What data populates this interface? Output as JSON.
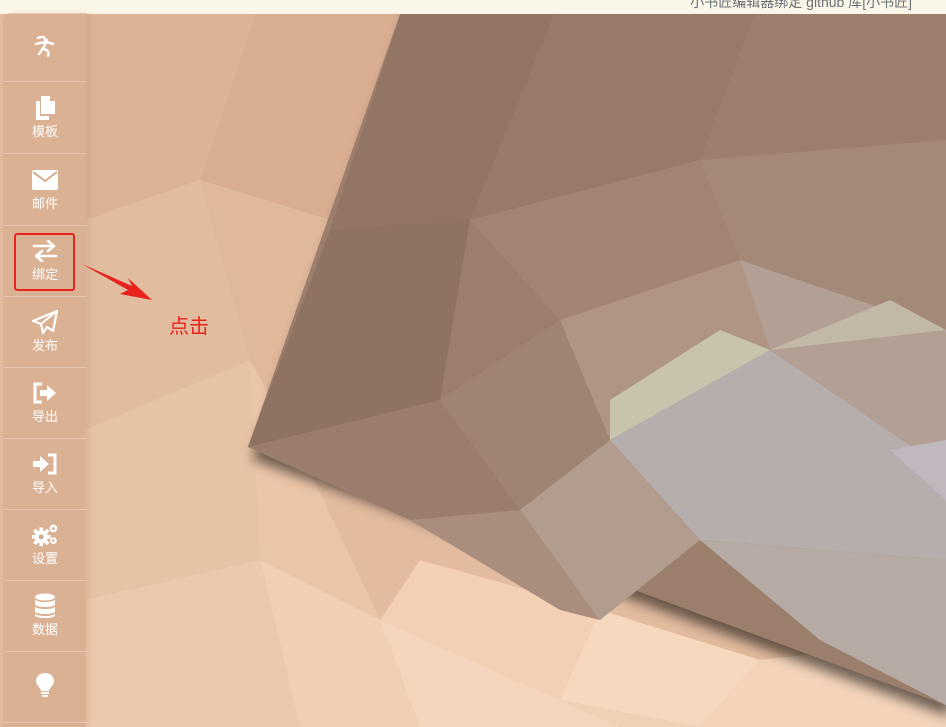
{
  "top_hint": "小书匠编辑器绑定 github 库[小书匠]",
  "logo_glyph": "≈",
  "nav": [
    {
      "label": "模板",
      "icon": "copy-icon"
    },
    {
      "label": "邮件",
      "icon": "envelope-icon"
    },
    {
      "label": "绑定",
      "icon": "exchange-icon"
    },
    {
      "label": "发布",
      "icon": "paper-plane-icon"
    },
    {
      "label": "导出",
      "icon": "sign-out-icon"
    },
    {
      "label": "导入",
      "icon": "sign-in-icon"
    },
    {
      "label": "设置",
      "icon": "cogs-icon"
    },
    {
      "label": "数据",
      "icon": "database-icon"
    },
    {
      "label": "",
      "icon": "lightbulb-icon"
    }
  ],
  "annotation": {
    "text": "点击",
    "color": "#e8231d"
  },
  "colors": {
    "accent_red": "#e8231d",
    "sidebar_text": "#ffffff"
  }
}
